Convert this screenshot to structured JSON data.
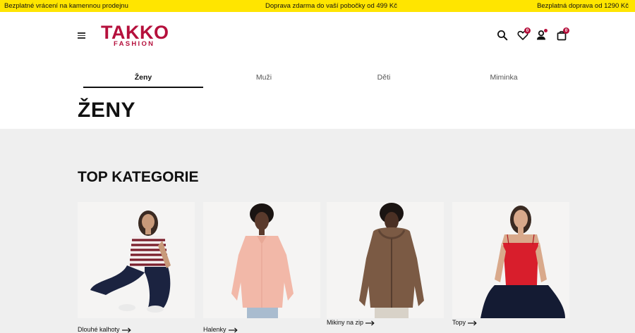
{
  "topbar": {
    "left": "Bezplatné vrácení na kamennou prodejnu",
    "center": "Doprava zdarma do vaší pobočky od 499 Kč",
    "right": "Bezplatná doprava od 1290 Kč",
    "color": "#ffe500"
  },
  "brand": {
    "name": "TAKKO",
    "tagline": "FASHION",
    "color": "#b5103c"
  },
  "header": {
    "wishlist_count": "0",
    "cart_count": "0",
    "icons": [
      "menu-icon",
      "search-icon",
      "heart-icon",
      "user-icon",
      "bag-icon"
    ]
  },
  "nav": {
    "tabs": [
      {
        "label": "Ženy",
        "active": true
      },
      {
        "label": "Muži",
        "active": false
      },
      {
        "label": "Děti",
        "active": false
      },
      {
        "label": "Miminka",
        "active": false
      }
    ]
  },
  "page": {
    "title": "ŽENY"
  },
  "top_categories": {
    "title": "TOP KATEGORIE",
    "items": [
      {
        "label": "Dlouhé kalhoty"
      },
      {
        "label": "Halenky"
      },
      {
        "label": "Mikiny na zip"
      },
      {
        "label": "Topy"
      }
    ]
  }
}
